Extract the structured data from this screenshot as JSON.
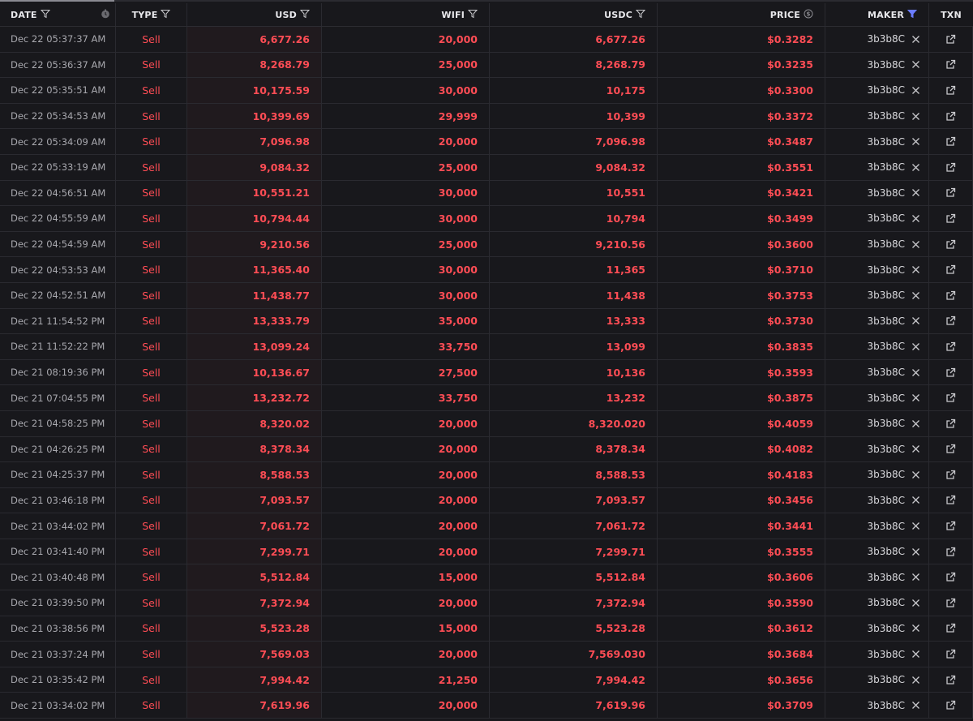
{
  "columns": {
    "date": "DATE",
    "type": "TYPE",
    "usd": "USD",
    "wifi": "WIFI",
    "usdc": "USDC",
    "price": "PRICE",
    "maker": "MAKER",
    "txn": "TXN"
  },
  "colors": {
    "sell": "#ff4d55",
    "background": "#18181c",
    "maker_filter_active": "#6b7cff"
  },
  "rows": [
    {
      "date": "Dec 22 05:37:37 AM",
      "type": "Sell",
      "usd": "6,677.26",
      "wifi": "20,000",
      "usdc": "6,677.26",
      "price": "$0.3282",
      "maker": "3b3b8C"
    },
    {
      "date": "Dec 22 05:36:37 AM",
      "type": "Sell",
      "usd": "8,268.79",
      "wifi": "25,000",
      "usdc": "8,268.79",
      "price": "$0.3235",
      "maker": "3b3b8C"
    },
    {
      "date": "Dec 22 05:35:51 AM",
      "type": "Sell",
      "usd": "10,175.59",
      "wifi": "30,000",
      "usdc": "10,175",
      "price": "$0.3300",
      "maker": "3b3b8C"
    },
    {
      "date": "Dec 22 05:34:53 AM",
      "type": "Sell",
      "usd": "10,399.69",
      "wifi": "29,999",
      "usdc": "10,399",
      "price": "$0.3372",
      "maker": "3b3b8C"
    },
    {
      "date": "Dec 22 05:34:09 AM",
      "type": "Sell",
      "usd": "7,096.98",
      "wifi": "20,000",
      "usdc": "7,096.98",
      "price": "$0.3487",
      "maker": "3b3b8C"
    },
    {
      "date": "Dec 22 05:33:19 AM",
      "type": "Sell",
      "usd": "9,084.32",
      "wifi": "25,000",
      "usdc": "9,084.32",
      "price": "$0.3551",
      "maker": "3b3b8C"
    },
    {
      "date": "Dec 22 04:56:51 AM",
      "type": "Sell",
      "usd": "10,551.21",
      "wifi": "30,000",
      "usdc": "10,551",
      "price": "$0.3421",
      "maker": "3b3b8C"
    },
    {
      "date": "Dec 22 04:55:59 AM",
      "type": "Sell",
      "usd": "10,794.44",
      "wifi": "30,000",
      "usdc": "10,794",
      "price": "$0.3499",
      "maker": "3b3b8C"
    },
    {
      "date": "Dec 22 04:54:59 AM",
      "type": "Sell",
      "usd": "9,210.56",
      "wifi": "25,000",
      "usdc": "9,210.56",
      "price": "$0.3600",
      "maker": "3b3b8C"
    },
    {
      "date": "Dec 22 04:53:53 AM",
      "type": "Sell",
      "usd": "11,365.40",
      "wifi": "30,000",
      "usdc": "11,365",
      "price": "$0.3710",
      "maker": "3b3b8C"
    },
    {
      "date": "Dec 22 04:52:51 AM",
      "type": "Sell",
      "usd": "11,438.77",
      "wifi": "30,000",
      "usdc": "11,438",
      "price": "$0.3753",
      "maker": "3b3b8C"
    },
    {
      "date": "Dec 21 11:54:52 PM",
      "type": "Sell",
      "usd": "13,333.79",
      "wifi": "35,000",
      "usdc": "13,333",
      "price": "$0.3730",
      "maker": "3b3b8C"
    },
    {
      "date": "Dec 21 11:52:22 PM",
      "type": "Sell",
      "usd": "13,099.24",
      "wifi": "33,750",
      "usdc": "13,099",
      "price": "$0.3835",
      "maker": "3b3b8C"
    },
    {
      "date": "Dec 21 08:19:36 PM",
      "type": "Sell",
      "usd": "10,136.67",
      "wifi": "27,500",
      "usdc": "10,136",
      "price": "$0.3593",
      "maker": "3b3b8C"
    },
    {
      "date": "Dec 21 07:04:55 PM",
      "type": "Sell",
      "usd": "13,232.72",
      "wifi": "33,750",
      "usdc": "13,232",
      "price": "$0.3875",
      "maker": "3b3b8C"
    },
    {
      "date": "Dec 21 04:58:25 PM",
      "type": "Sell",
      "usd": "8,320.02",
      "wifi": "20,000",
      "usdc": "8,320.020",
      "price": "$0.4059",
      "maker": "3b3b8C"
    },
    {
      "date": "Dec 21 04:26:25 PM",
      "type": "Sell",
      "usd": "8,378.34",
      "wifi": "20,000",
      "usdc": "8,378.34",
      "price": "$0.4082",
      "maker": "3b3b8C"
    },
    {
      "date": "Dec 21 04:25:37 PM",
      "type": "Sell",
      "usd": "8,588.53",
      "wifi": "20,000",
      "usdc": "8,588.53",
      "price": "$0.4183",
      "maker": "3b3b8C"
    },
    {
      "date": "Dec 21 03:46:18 PM",
      "type": "Sell",
      "usd": "7,093.57",
      "wifi": "20,000",
      "usdc": "7,093.57",
      "price": "$0.3456",
      "maker": "3b3b8C"
    },
    {
      "date": "Dec 21 03:44:02 PM",
      "type": "Sell",
      "usd": "7,061.72",
      "wifi": "20,000",
      "usdc": "7,061.72",
      "price": "$0.3441",
      "maker": "3b3b8C"
    },
    {
      "date": "Dec 21 03:41:40 PM",
      "type": "Sell",
      "usd": "7,299.71",
      "wifi": "20,000",
      "usdc": "7,299.71",
      "price": "$0.3555",
      "maker": "3b3b8C"
    },
    {
      "date": "Dec 21 03:40:48 PM",
      "type": "Sell",
      "usd": "5,512.84",
      "wifi": "15,000",
      "usdc": "5,512.84",
      "price": "$0.3606",
      "maker": "3b3b8C"
    },
    {
      "date": "Dec 21 03:39:50 PM",
      "type": "Sell",
      "usd": "7,372.94",
      "wifi": "20,000",
      "usdc": "7,372.94",
      "price": "$0.3590",
      "maker": "3b3b8C"
    },
    {
      "date": "Dec 21 03:38:56 PM",
      "type": "Sell",
      "usd": "5,523.28",
      "wifi": "15,000",
      "usdc": "5,523.28",
      "price": "$0.3612",
      "maker": "3b3b8C"
    },
    {
      "date": "Dec 21 03:37:24 PM",
      "type": "Sell",
      "usd": "7,569.03",
      "wifi": "20,000",
      "usdc": "7,569.030",
      "price": "$0.3684",
      "maker": "3b3b8C"
    },
    {
      "date": "Dec 21 03:35:42 PM",
      "type": "Sell",
      "usd": "7,994.42",
      "wifi": "21,250",
      "usdc": "7,994.42",
      "price": "$0.3656",
      "maker": "3b3b8C"
    },
    {
      "date": "Dec 21 03:34:02 PM",
      "type": "Sell",
      "usd": "7,619.96",
      "wifi": "20,000",
      "usdc": "7,619.96",
      "price": "$0.3709",
      "maker": "3b3b8C"
    }
  ]
}
